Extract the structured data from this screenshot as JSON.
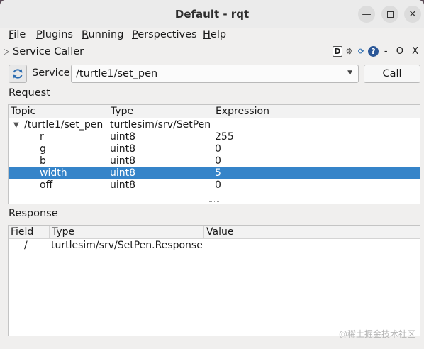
{
  "window": {
    "title": "Default - rqt"
  },
  "menus": [
    {
      "label": "File",
      "key": "F",
      "rest": "ile"
    },
    {
      "label": "Plugins",
      "key": "P",
      "rest": "lugins"
    },
    {
      "label": "Running",
      "key": "R",
      "rest": "unning"
    },
    {
      "label": "Perspectives",
      "key": "P",
      "rest": "erspectives"
    },
    {
      "label": "Help",
      "key": "H",
      "rest": "elp"
    }
  ],
  "plugin": {
    "name": "Service Caller",
    "icons": [
      "dock-icon",
      "gear-icon",
      "refresh-icon",
      "help-icon"
    ],
    "dock_label": "D",
    "controls_text": "- O X"
  },
  "service": {
    "label": "Service",
    "value": "/turtle1/set_pen",
    "call_label": "Call"
  },
  "request": {
    "section_label": "Request",
    "columns": [
      "Topic",
      "Type",
      "Expression"
    ],
    "rows": [
      {
        "topic": "/turtle1/set_pen",
        "type": "turtlesim/srv/SetPen",
        "expression": "",
        "expanded": true
      },
      {
        "topic": "r",
        "type": "uint8",
        "expression": "255"
      },
      {
        "topic": "g",
        "type": "uint8",
        "expression": "0"
      },
      {
        "topic": "b",
        "type": "uint8",
        "expression": "0"
      },
      {
        "topic": "width",
        "type": "uint8",
        "expression": "5",
        "selected": true
      },
      {
        "topic": "off",
        "type": "uint8",
        "expression": "0"
      }
    ]
  },
  "response": {
    "section_label": "Response",
    "columns": [
      "Field",
      "Type",
      "Value"
    ],
    "rows": [
      {
        "field": "/",
        "type": "turtlesim/srv/SetPen.Response",
        "value": ""
      }
    ]
  },
  "watermark": "@稀土掘金技术社区",
  "colors": {
    "selection": "#3584c9",
    "help_icon": "#2b5797"
  }
}
